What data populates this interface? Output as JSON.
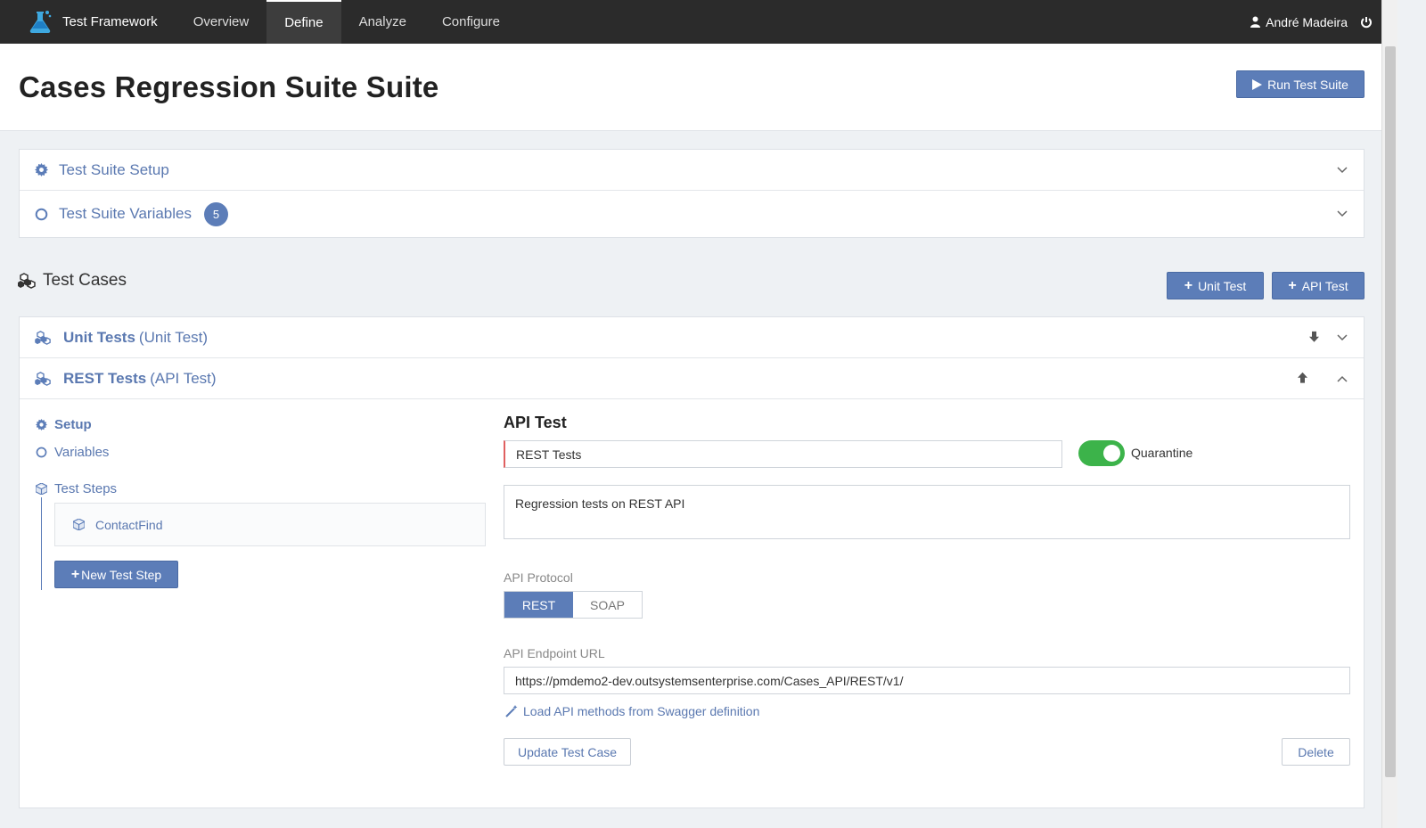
{
  "nav": {
    "brand": "Test Framework",
    "items": [
      {
        "label": "Overview",
        "active": false
      },
      {
        "label": "Define",
        "active": true
      },
      {
        "label": "Analyze",
        "active": false
      },
      {
        "label": "Configure",
        "active": false
      }
    ],
    "user": "André Madeira"
  },
  "header": {
    "title": "Cases Regression Suite Suite",
    "run_label": "Run Test Suite"
  },
  "suite_panel": {
    "setup_label": "Test Suite Setup",
    "variables_label": "Test Suite Variables",
    "variables_count": "5"
  },
  "test_cases": {
    "title": "Test Cases",
    "add_unit_label": "Unit Test",
    "add_api_label": "API Test",
    "cases": [
      {
        "name": "Unit Tests",
        "type": "(Unit Test)",
        "expanded": false
      },
      {
        "name": "REST Tests",
        "type": "(API Test)",
        "expanded": true
      }
    ]
  },
  "case_detail": {
    "menu": {
      "setup": "Setup",
      "variables": "Variables",
      "steps": "Test Steps",
      "step_items": [
        "ContactFind"
      ],
      "new_step_label": "New Test Step"
    },
    "form": {
      "title": "API Test",
      "name_value": "REST Tests",
      "quarantine_label": "Quarantine",
      "quarantine_on": true,
      "description": "Regression tests on REST API",
      "protocol_label": "API Protocol",
      "protocol_options": [
        "REST",
        "SOAP"
      ],
      "protocol_selected": "REST",
      "endpoint_label": "API Endpoint URL",
      "endpoint_value": "https://pmdemo2-dev.outsystemsenterprise.com/Cases_API/REST/v1/",
      "swagger_link": "Load API methods from Swagger definition",
      "update_label": "Update Test Case",
      "delete_label": "Delete"
    }
  },
  "colors": {
    "accent": "#5c7db8",
    "nav_bg": "#2b2b2b",
    "toggle_on": "#3cb34a"
  }
}
